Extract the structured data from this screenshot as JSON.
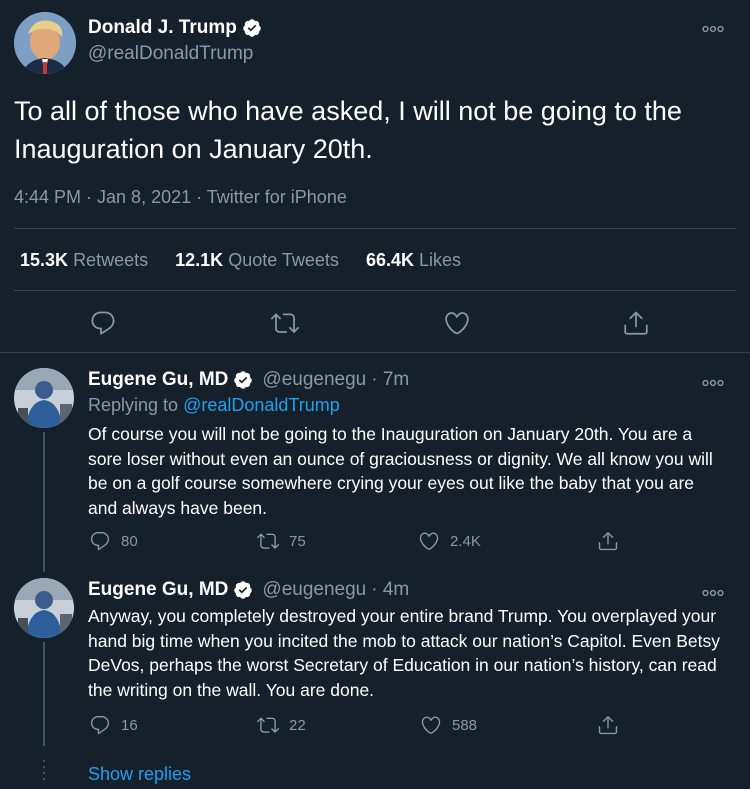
{
  "main_tweet": {
    "author_name": "Donald J. Trump",
    "author_handle": "@realDonaldTrump",
    "text": "To all of those who have asked, I will not be going to the Inauguration on January 20th.",
    "meta": "4:44 PM · Jan 8, 2021 · Twitter for iPhone",
    "stats": {
      "retweets_count": "15.3K",
      "retweets_label": "Retweets",
      "quotes_count": "12.1K",
      "quotes_label": "Quote Tweets",
      "likes_count": "66.4K",
      "likes_label": "Likes"
    }
  },
  "replies": [
    {
      "author_name": "Eugene Gu, MD",
      "author_handle": "@eugenegu",
      "time": "· 7m",
      "replying_prefix": "Replying to",
      "replying_to": "@realDonaldTrump",
      "text": "Of course you will not be going to the Inauguration on January 20th. You are a sore loser without even an ounce of graciousness or dignity. We all know you will be on a golf course somewhere crying your eyes out like the baby that you are and always have been.",
      "reply_count": "80",
      "retweet_count": "75",
      "like_count": "2.4K"
    },
    {
      "author_name": "Eugene Gu, MD",
      "author_handle": "@eugenegu",
      "time": "· 4m",
      "text": "Anyway, you completely destroyed your entire brand Trump. You overplayed your hand big time when you incited the mob to attack our nation’s Capitol. Even Betsy DeVos, perhaps the worst Secretary of Education in our nation’s history, can read the writing on the wall. You are done.",
      "reply_count": "16",
      "retweet_count": "22",
      "like_count": "588"
    }
  ],
  "show_replies_label": "Show replies",
  "colors": {
    "background": "#15202b",
    "text": "#ffffff",
    "muted": "#8899a6",
    "accent": "#1da1f2",
    "divider": "#38444d"
  },
  "icons": [
    "verified-badge-icon",
    "more-icon",
    "reply-icon",
    "retweet-icon",
    "like-icon",
    "share-icon"
  ]
}
